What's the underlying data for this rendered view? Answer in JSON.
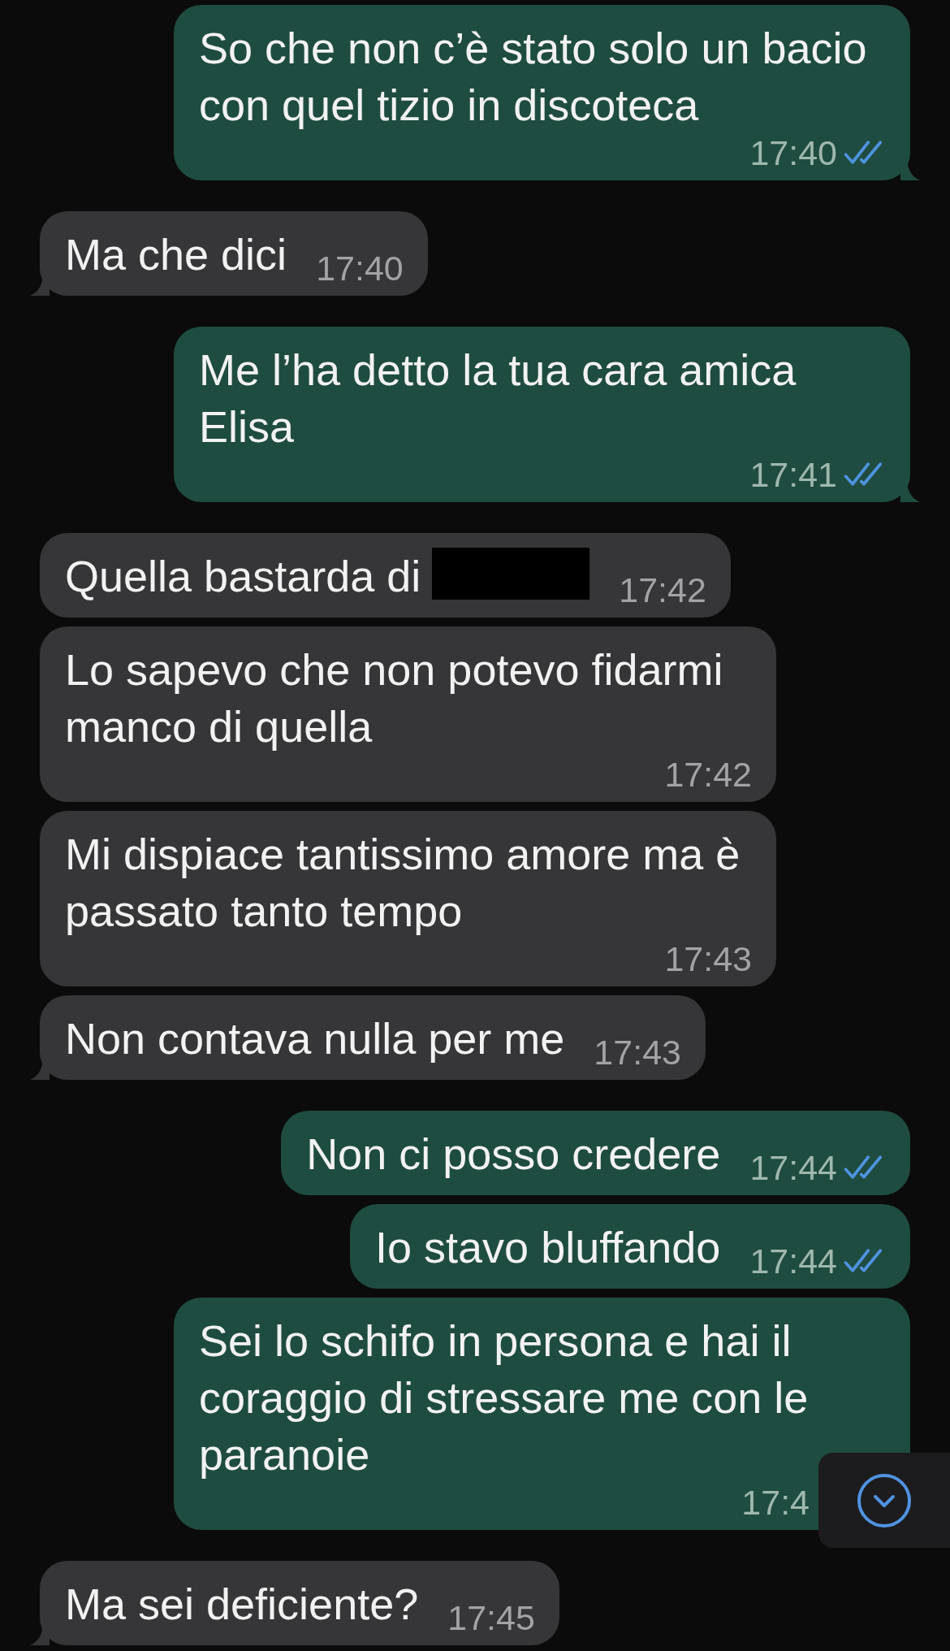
{
  "messages": [
    {
      "outgoing": true,
      "text": "So che non c’è stato solo un bacio con quel tizio in discoteca",
      "time": "17:40",
      "read": true,
      "tail": true
    },
    {
      "outgoing": false,
      "text": "Ma che dici",
      "time": "17:40",
      "tail": true
    },
    {
      "outgoing": true,
      "text": "Me l’ha detto la tua cara amica Elisa",
      "time": "17:41",
      "read": true,
      "tail": true
    },
    {
      "outgoing": false,
      "text": "Quella bastarda di",
      "time": "17:42",
      "redacted": true,
      "tail": false
    },
    {
      "outgoing": false,
      "text": "Lo sapevo che non potevo fidarmi manco di quella",
      "time": "17:42",
      "tail": false
    },
    {
      "outgoing": false,
      "text": "Mi dispiace tantissimo amore ma è passato tanto tempo",
      "time": "17:43",
      "tail": false
    },
    {
      "outgoing": false,
      "text": "Non contava nulla per me",
      "time": "17:43",
      "tail": true
    },
    {
      "outgoing": true,
      "text": "Non ci posso credere",
      "time": "17:44",
      "read": true,
      "tail": false
    },
    {
      "outgoing": true,
      "text": "Io stavo bluffando",
      "time": "17:44",
      "read": true,
      "tail": false
    },
    {
      "outgoing": true,
      "text": "Sei lo schifo in persona e hai il coraggio di stressare me con le paranoie",
      "time": "17:4",
      "tail": false
    },
    {
      "outgoing": false,
      "text": "Ma sei deficiente?",
      "time": "17:45",
      "tail": true
    }
  ]
}
